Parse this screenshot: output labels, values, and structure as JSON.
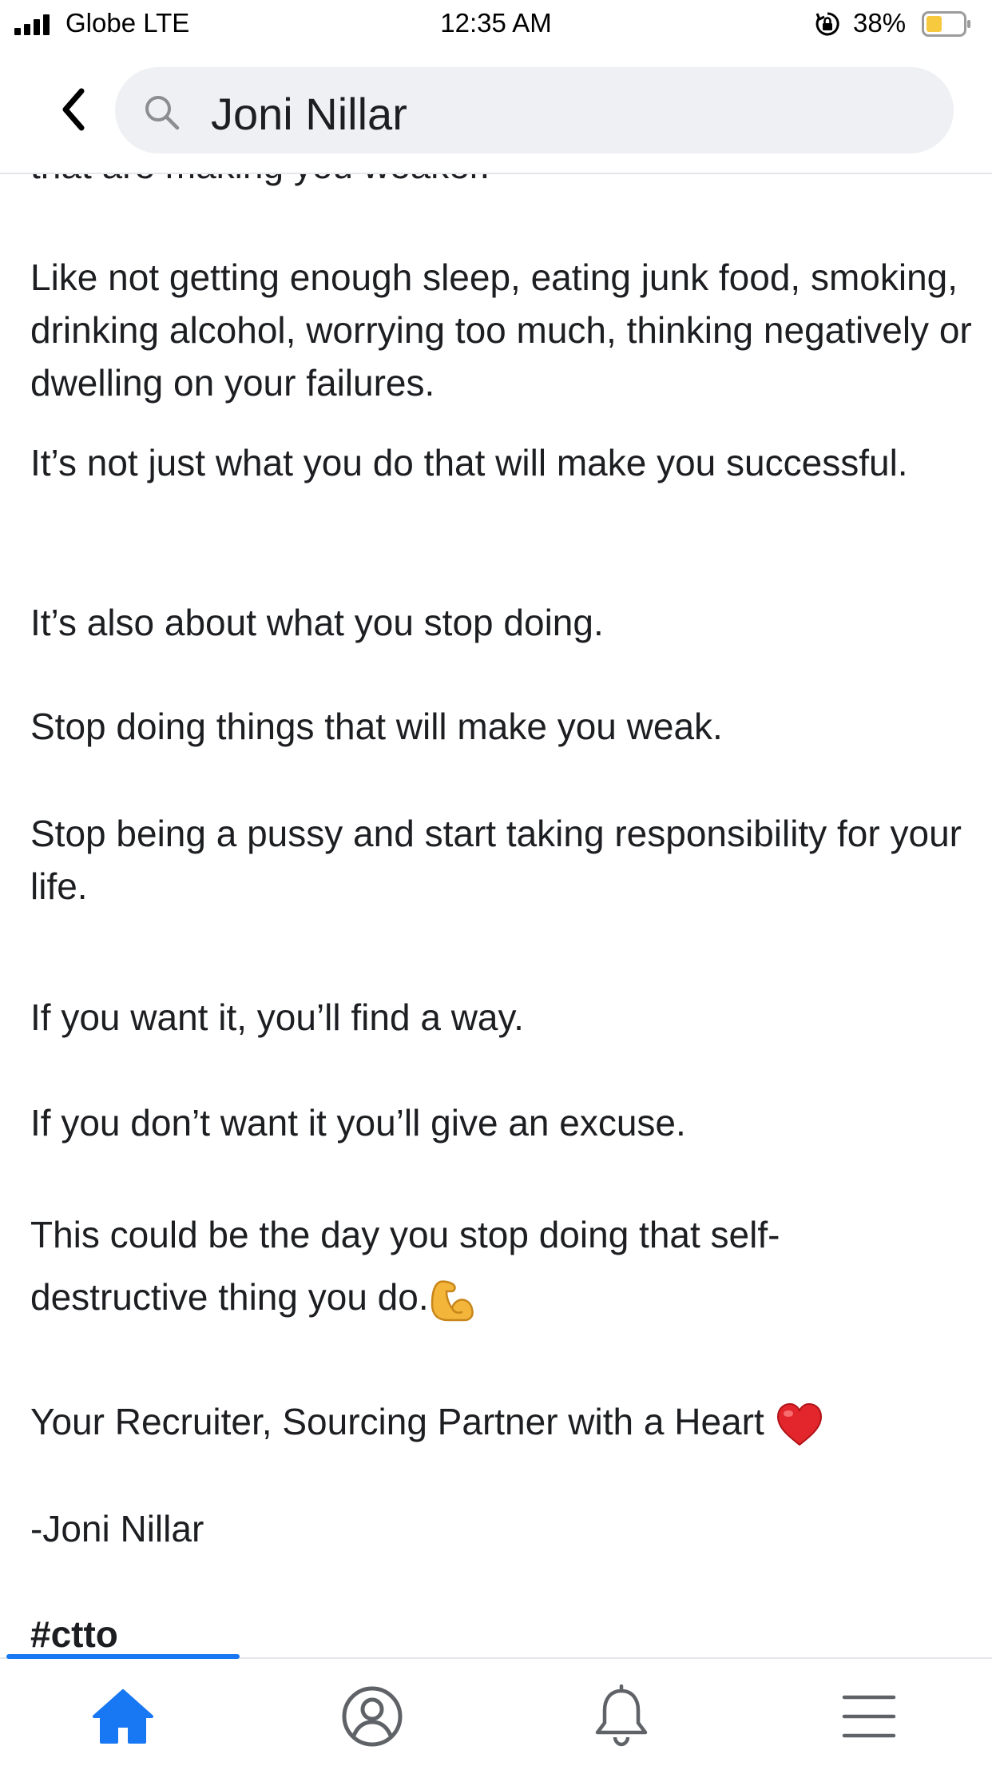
{
  "status_bar": {
    "carrier": "Globe LTE",
    "time": "12:35 AM",
    "battery_percent": "38%"
  },
  "search": {
    "query": "Joni Nillar"
  },
  "post": {
    "cut_line": "that are making you weaker.",
    "paragraphs": [
      "Like not getting enough sleep, eating junk food, smoking, drinking alcohol, worrying too much, thinking negatively or dwelling on your failures.",
      "It’s not just what you do that will make you successful.",
      "It’s also about what you stop doing.",
      "Stop doing things that will make you weak.",
      "Stop being a pussy and start taking responsibility for your life.",
      "If you want it, you’ll find a way.",
      "If you don’t want it you’ll give an excuse.",
      "This could be the day you stop doing that self-destructive thing you do.",
      "Your Recruiter, Sourcing Partner with a Heart",
      "-Joni Nillar",
      "#ctto"
    ]
  },
  "bottom_nav": {
    "active_tab": "home",
    "tabs": [
      "home",
      "profile",
      "notifications",
      "menu"
    ],
    "accent_color": "#1877f2"
  }
}
